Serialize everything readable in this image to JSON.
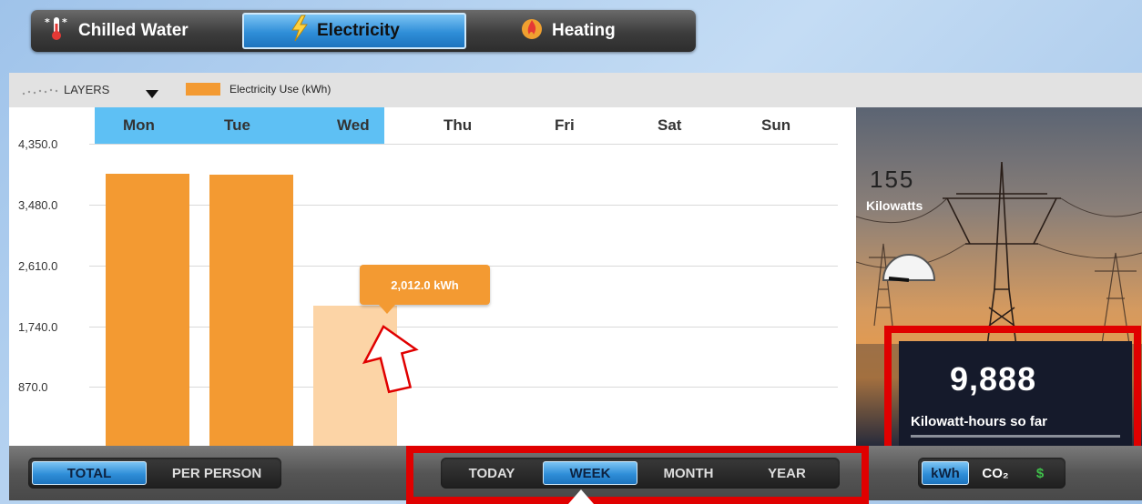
{
  "tabs": [
    {
      "label": "Chilled Water",
      "icon": "thermometer-snowflake-icon",
      "active": false
    },
    {
      "label": "Electricity",
      "icon": "lightning-bolt-icon",
      "active": true
    },
    {
      "label": "Heating",
      "icon": "flame-icon",
      "active": false
    }
  ],
  "layers": {
    "dropdown_label": "LAYERS",
    "legend_label": "Electricity Use (kWh)",
    "legend_color": "#f39a32"
  },
  "chart_data": {
    "type": "bar",
    "categories": [
      "Mon",
      "Tue",
      "Wed",
      "Thu",
      "Fri",
      "Sat",
      "Sun"
    ],
    "values": [
      3920,
      3900,
      2012,
      null,
      null,
      null,
      null
    ],
    "ytick_labels": [
      "4,350.0",
      "3,480.0",
      "2,610.0",
      "1,740.0",
      "870.0"
    ],
    "ylim": [
      0,
      4350
    ],
    "bar_color": "#f39a32",
    "highlight_color": "#fcd4a6",
    "highlight_index": 2,
    "tooltip": "2,012.0 kWh",
    "current_days_highlight": "#5ec0f4"
  },
  "live": {
    "power_value": "155",
    "power_unit": "Kilowatts",
    "total_value": "9,888",
    "total_label": "Kilowatt-hours so far"
  },
  "bottom": {
    "mode_buttons": [
      {
        "label": "TOTAL",
        "active": true
      },
      {
        "label": "PER PERSON",
        "active": false
      }
    ],
    "range_buttons": [
      {
        "label": "TODAY",
        "active": false
      },
      {
        "label": "WEEK",
        "active": true
      },
      {
        "label": "MONTH",
        "active": false
      },
      {
        "label": "YEAR",
        "active": false
      }
    ],
    "unit_buttons": [
      {
        "label": "kWh",
        "active": true
      },
      {
        "label": "CO₂",
        "active": false
      },
      {
        "label": "$",
        "active": false
      }
    ]
  }
}
